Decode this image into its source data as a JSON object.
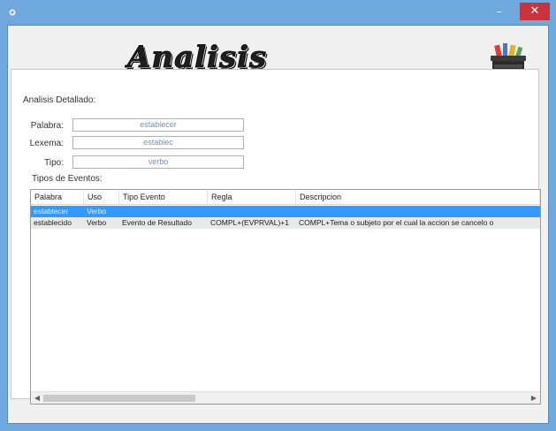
{
  "window": {
    "close_label": "✕",
    "minimize_label": "–"
  },
  "header": {
    "title": "Analisis Detallado"
  },
  "form": {
    "group_label": "Analisis Detallado:",
    "palabra_label": "Palabra:",
    "palabra_value": "establecer",
    "lexema_label": "Lexema:",
    "lexema_value": "establec",
    "tipo_label": "Tipo:",
    "tipo_value": "verbo"
  },
  "events": {
    "label": "Tipos de Eventos:",
    "columns": [
      "Palabra",
      "Uso",
      "Tipo Evento",
      "Regla",
      "Descripcion"
    ],
    "rows": [
      {
        "selected": true,
        "cells": [
          "establecer",
          "Verbo",
          "",
          "",
          ""
        ]
      },
      {
        "selected": false,
        "cells": [
          "establecido",
          "Verbo",
          "Evento de Resultado",
          "COMPL+(EVPRVAL)+1",
          "COMPL+Tema o subjeto por el cual la accion se cancelo o"
        ]
      }
    ]
  },
  "colors": {
    "title_bar": "#6ea8dc",
    "close_button": "#c8343b",
    "selection": "#3399ff"
  },
  "icons": {
    "app": "app-icon",
    "toolbox": "toolbox-icon"
  }
}
